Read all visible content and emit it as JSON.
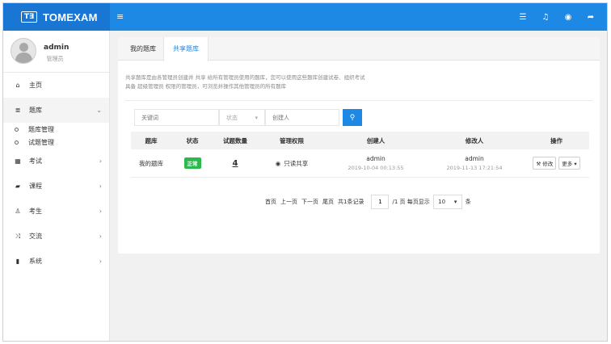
{
  "header": {
    "brand_mark": "T∃",
    "brand_name": "TOMEXAM",
    "menu_icon": "bars-icon",
    "icons": [
      "list-icon",
      "bell-icon",
      "user-circle-icon",
      "sign-out-icon"
    ]
  },
  "user": {
    "name": "admin",
    "role": "管理员"
  },
  "sidebar": {
    "items": [
      {
        "label": "主页",
        "icon": "home-icon"
      },
      {
        "label": "题库",
        "icon": "database-icon",
        "expanded": true,
        "children": [
          {
            "label": "题库管理"
          },
          {
            "label": "试题管理"
          }
        ]
      },
      {
        "label": "考试",
        "icon": "calendar-icon"
      },
      {
        "label": "课程",
        "icon": "book-icon"
      },
      {
        "label": "考生",
        "icon": "user-icon"
      },
      {
        "label": "交流",
        "icon": "shuffle-icon"
      },
      {
        "label": "系统",
        "icon": "cylinder-icon"
      }
    ]
  },
  "tabs": [
    {
      "label": "我的题库"
    },
    {
      "label": "共享题库",
      "active": true
    }
  ],
  "description": {
    "line1": "共享题库是由各管理员创建并 共享 给所有管理员使用的题库，您可以使用这些题库创建试卷、组织考试",
    "line2": "具备 超级管理员 权限的管理员，可浏览并操作其他管理员的所有题库"
  },
  "search": {
    "keyword_placeholder": "关键词",
    "status_label": "状态",
    "creator_placeholder": "创建人"
  },
  "table": {
    "headers": [
      "题库",
      "状态",
      "试题数量",
      "管理权限",
      "创建人",
      "修改人",
      "操作"
    ],
    "rows": [
      {
        "name": "我的题库",
        "status": "正常",
        "count": "4",
        "permission": "只读共享",
        "creator": "admin",
        "created_at": "2019-10-04 00:13:55",
        "modifier": "admin",
        "modified_at": "2019-11-13 17:21:54",
        "edit_label": "修改",
        "more_label": "更多"
      }
    ]
  },
  "pager": {
    "first": "首页",
    "prev": "上一页",
    "next": "下一页",
    "last": "尾页",
    "total": "共1条记录",
    "page": "1",
    "pages_text": "/1 页 每页显示",
    "page_size": "10",
    "unit": "条"
  },
  "colors": {
    "primary": "#1e88e5",
    "brand_bg": "#1976d2",
    "success": "#2db84d"
  }
}
